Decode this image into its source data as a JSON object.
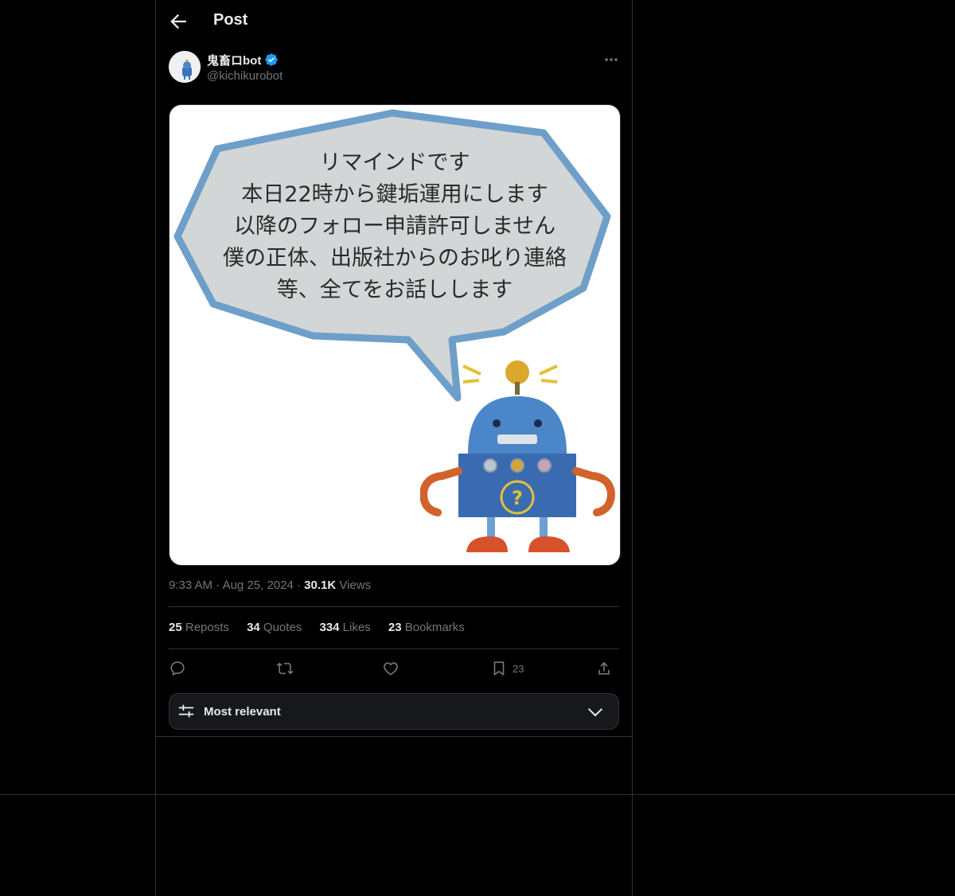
{
  "header": {
    "title": "Post"
  },
  "author": {
    "name": "鬼畜ロbot",
    "handle": "@kichikurobot"
  },
  "media": {
    "lines": [
      "リマインドです",
      "本日22時から鍵垢運用にします",
      "以降のフォロー申請許可しません",
      "僕の正体、出版社からのお叱り連絡",
      "等、全てをお話しします"
    ]
  },
  "meta": {
    "time": "9:33 AM",
    "date": "Aug 25, 2024",
    "views_count": "30.1K",
    "views_label": "Views",
    "sep": "·"
  },
  "stats": {
    "reposts": {
      "count": "25",
      "label": "Reposts"
    },
    "quotes": {
      "count": "34",
      "label": "Quotes"
    },
    "likes": {
      "count": "334",
      "label": "Likes"
    },
    "bookmarks": {
      "count": "23",
      "label": "Bookmarks"
    }
  },
  "actions": {
    "bookmark_count": "23"
  },
  "sort": {
    "label": "Most relevant"
  },
  "colors": {
    "background": "#000000",
    "border": "#2f3336",
    "text": "#e7e9ea",
    "muted": "#71767b",
    "verified": "#1d9bf0"
  }
}
